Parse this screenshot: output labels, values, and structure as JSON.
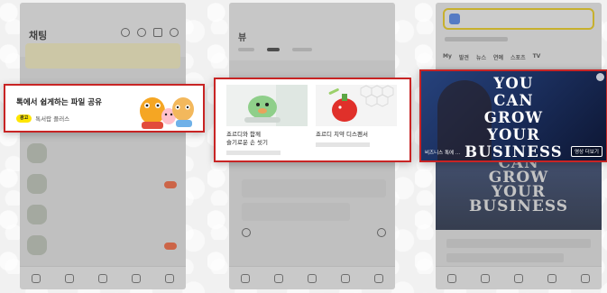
{
  "phone1": {
    "title": "채팅",
    "banner": {
      "title": "톡에서 쉽게하는 파일 공유",
      "badge": "광고",
      "subtitle": "톡서랍 플러스"
    }
  },
  "phone2": {
    "logo": "뷰",
    "products": [
      {
        "title": "죠르디와 함께\n슬기로운 손 씻기"
      },
      {
        "title": "죠르디 치약 디스펜서"
      }
    ]
  },
  "phone3": {
    "tabs": [
      "My",
      "발견",
      "뉴스",
      "연예",
      "스포츠",
      "TV"
    ],
    "ad": {
      "headline": [
        "YOU",
        "CAN",
        "GROW",
        "YOUR",
        "BUSINESS"
      ],
      "caption": "비즈니스 톡에 ...",
      "cta": "영상 더보기"
    }
  },
  "colors": {
    "highlight_border": "#c82424",
    "kakao_yellow": "#ffe600",
    "ad_blue": "#1b2f5e"
  }
}
